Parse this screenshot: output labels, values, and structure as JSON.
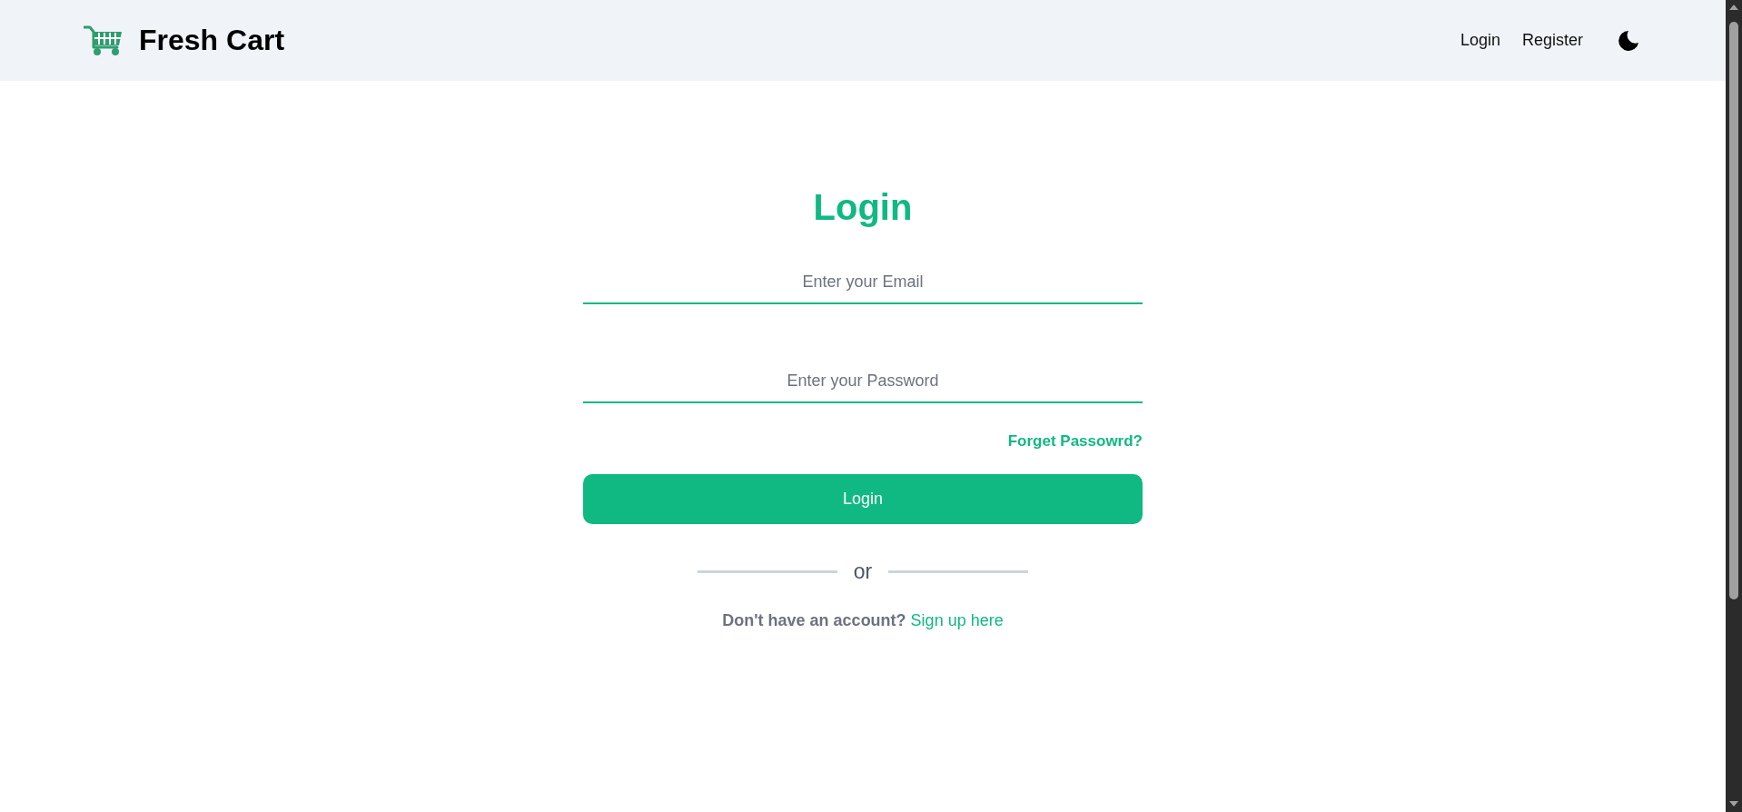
{
  "header": {
    "brand": "Fresh Cart",
    "nav": [
      {
        "label": "Login"
      },
      {
        "label": "Register"
      }
    ]
  },
  "login_form": {
    "title": "Login",
    "fields": [
      {
        "placeholder": "Enter your Email"
      },
      {
        "placeholder": "Enter your Password"
      }
    ],
    "forgot_link": "Forget Passowrd?",
    "submit": "Login",
    "divider": "or",
    "signup": {
      "prompt": "Don't have an account?",
      "link": "Sign up here"
    }
  }
}
